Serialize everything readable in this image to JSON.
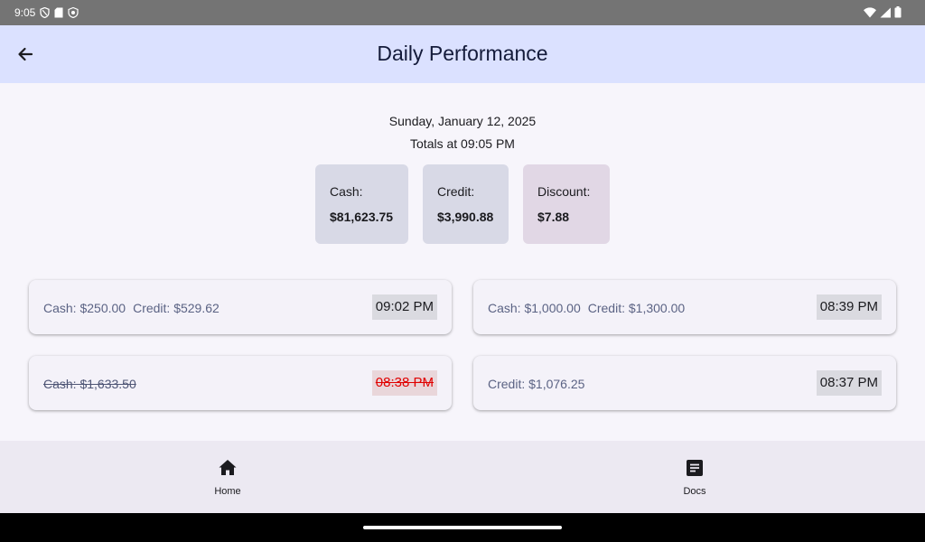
{
  "status_bar": {
    "time": "9:05",
    "left_icons": [
      "shield-icon",
      "sd-card-icon",
      "vpn-icon"
    ],
    "right_icons": [
      "wifi-icon",
      "signal-icon",
      "battery-icon"
    ]
  },
  "app_bar": {
    "title": "Daily Performance",
    "back_icon": "arrow-back-icon"
  },
  "header": {
    "date": "Sunday, January 12, 2025",
    "totals_time": "Totals at 09:05 PM"
  },
  "summary": {
    "cash_label": "Cash:",
    "cash_value": "$81,623.75",
    "credit_label": "Credit:",
    "credit_value": "$3,990.88",
    "discount_label": "Discount:",
    "discount_value": "$7.88"
  },
  "transactions": [
    {
      "cash": "Cash: $250.00",
      "credit": "Credit: $529.62",
      "time": "09:02 PM",
      "voided": false
    },
    {
      "cash": "Cash: $1,000.00",
      "credit": "Credit: $1,300.00",
      "time": "08:39 PM",
      "voided": false
    },
    {
      "cash": "Cash: $1,633.50",
      "credit": "",
      "time": "08:38 PM",
      "voided": true
    },
    {
      "cash": "",
      "credit": "Credit: $1,076.25",
      "time": "08:37 PM",
      "voided": false
    }
  ],
  "bottom_nav": {
    "items": [
      {
        "label": "Home",
        "icon": "home-icon"
      },
      {
        "label": "Docs",
        "icon": "document-icon"
      }
    ]
  },
  "colors": {
    "app_bar": "#dbe1ff",
    "void_time": "#e00000",
    "summary_cash": "#d8d9e6",
    "summary_discount": "#e1d7e5"
  }
}
